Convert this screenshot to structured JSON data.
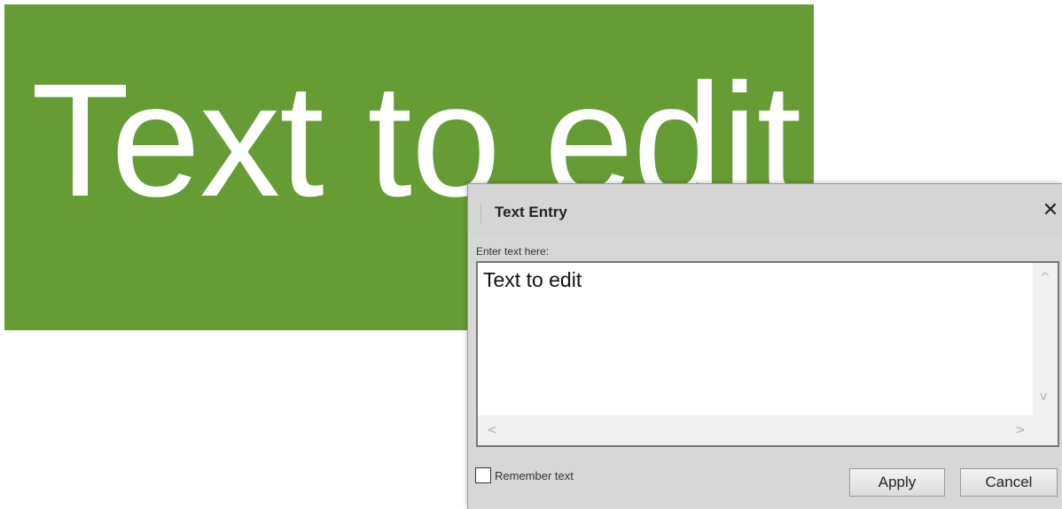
{
  "banner": {
    "text": "Text to edit",
    "color": "#659c34"
  },
  "dialog": {
    "title": "Text Entry",
    "close_icon": "close-icon",
    "close_glyph": "✕",
    "prompt_label": "Enter text here:",
    "text_value": "Text to edit",
    "scroll_up": "^",
    "scroll_down": "v",
    "scroll_left": "<",
    "scroll_right": ">",
    "remember_label": "Remember text",
    "remember_checked": false,
    "apply_label": "Apply",
    "cancel_label": "Cancel"
  }
}
